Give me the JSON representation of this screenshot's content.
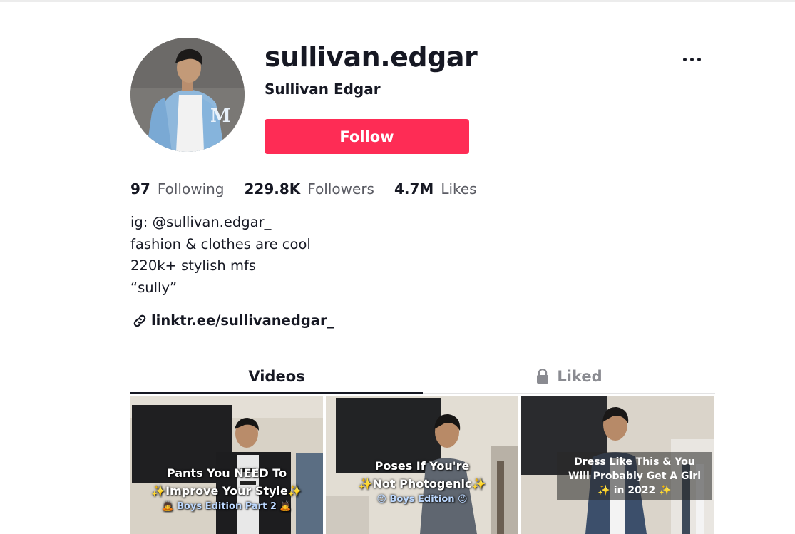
{
  "profile": {
    "username": "sullivan.edgar",
    "display_name": "Sullivan Edgar",
    "follow_label": "Follow",
    "more_icon": "more-horizontal-icon"
  },
  "stats": [
    {
      "value": "97",
      "label": "Following"
    },
    {
      "value": "229.8K",
      "label": "Followers"
    },
    {
      "value": "4.7M",
      "label": "Likes"
    }
  ],
  "bio": {
    "lines": [
      "ig: @sullivan.edgar_",
      "fashion & clothes are cool",
      "220k+ stylish mfs",
      "“sully”"
    ]
  },
  "link": {
    "text": "linktr.ee/sullivanedgar_",
    "icon": "link-icon"
  },
  "tabs": {
    "videos_label": "Videos",
    "liked_label": "Liked",
    "liked_icon": "lock-icon",
    "active": "Videos"
  },
  "videos": [
    {
      "line1": "Pants You NEED To",
      "line2": "✨Improve Your Style✨",
      "line3": "🙇 Boys Edition Part 2 🙇"
    },
    {
      "line1": "Poses If You're",
      "line2": "✨Not Photogenic✨",
      "line3": "😉 Boys Edition 😉"
    },
    {
      "line1": "Dress Like This & You",
      "line2": "Will Probably Get A Girl",
      "line3": "✨ in 2022 ✨"
    }
  ],
  "colors": {
    "accent": "#fe2c55",
    "text": "#161823",
    "secondary_text": "#5a5b63"
  }
}
